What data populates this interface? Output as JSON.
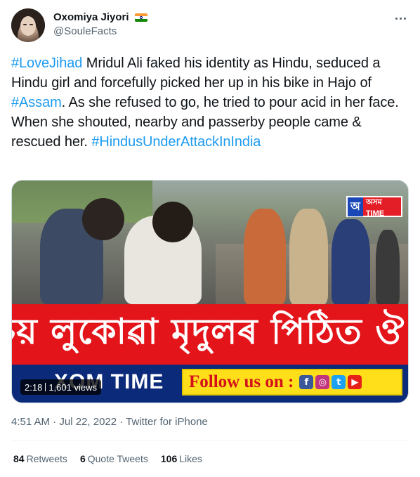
{
  "header": {
    "display_name": "Oxomiya Jiyori",
    "handle": "@SouleFacts",
    "flag": "india-flag"
  },
  "tweet": {
    "segments": [
      {
        "text": "#LoveJihad",
        "hashtag": true
      },
      {
        "text": " Mridul Ali faked his identity as Hindu, seduced a Hindu girl and forcefully picked her up in his bike in Hajo of ",
        "hashtag": false
      },
      {
        "text": "#Assam",
        "hashtag": true
      },
      {
        "text": ". As she refused to go, he tried to pour acid in her face. When she shouted, nearby and passerby people came & rescued her. ",
        "hashtag": false
      },
      {
        "text": "#HindusUnderAttackInIndia",
        "hashtag": true
      }
    ]
  },
  "media": {
    "channel_bug_letter": "অ",
    "channel_bug_text": "অসম TIME",
    "banner_text": "পৰিচয় লুকোৱা মৃদুলৰ পিঠিত ঔ কিল",
    "brand_text": "XOM TIME",
    "follow_text": "Follow us on :",
    "social_icons": [
      "f",
      "◎",
      "t",
      "▶"
    ],
    "duration": "2:18",
    "views": "1,601 views"
  },
  "meta": {
    "timestamp": "4:51 AM · Jul 22, 2022 · Twitter for iPhone"
  },
  "stats": {
    "retweets_count": "84",
    "retweets_label": "Retweets",
    "quotes_count": "6",
    "quotes_label": "Quote Tweets",
    "likes_count": "106",
    "likes_label": "Likes"
  },
  "colors": {
    "link": "#1d9bf0",
    "banner_red": "#e4141b",
    "lower_blue": "#0b2a7a",
    "follow_yellow": "#ffdf1a"
  }
}
